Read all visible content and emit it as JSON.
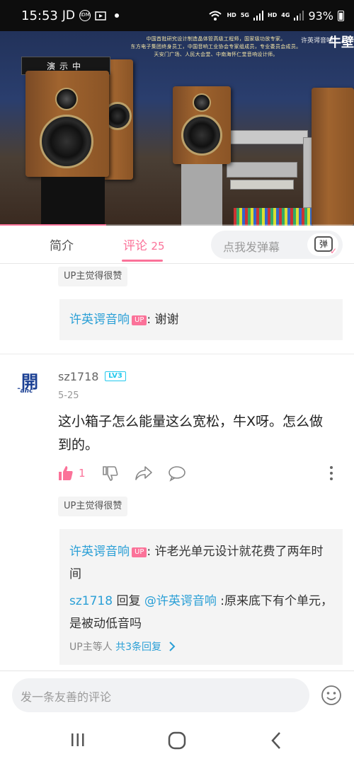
{
  "status_bar": {
    "time": "15:53",
    "carrier": "JD",
    "battery": "93%",
    "net_hd_1": "HD",
    "net_5g": "5G",
    "net_hd_2": "HD",
    "net_4g": "4G"
  },
  "video": {
    "banner_line1": "中国首批研究设计制造晶体管高级工程师，国家级功放专家。",
    "banner_line2": "东方电子集团终身员工，中国音响工业协会专家组成员，专业委员会成员。",
    "banner_line3": "天安门广场、人民大会堂、中南海怀仁堂音响设计师。",
    "watermark": "许英谔音响",
    "corner_text": "牛壁",
    "sign_text": "演示中",
    "progress_fraction": 0.3
  },
  "tabs": {
    "intro": "简介",
    "comments": "评论",
    "comments_count": "25",
    "danmaku_placeholder": "点我发弹幕",
    "danmaku_button": "弹"
  },
  "thread1": {
    "badge": "UP主觉得很赞",
    "reply_author": "许英谔音响",
    "up_tag": "UP",
    "reply_text": ": 谢谢"
  },
  "comment2": {
    "avatar_mark": "開",
    "avatar_sub": "Canc",
    "username": "sz1718",
    "level": "LV3",
    "date": "5-25",
    "text": "这小箱子怎么能量这么宽松，牛X呀。怎么做到的。",
    "like_count": "1",
    "badge": "UP主觉得很赞",
    "reply1_author": "许英谔音响",
    "reply1_up_tag": "UP",
    "reply1_text": ": 许老光单元设计就花费了两年时间",
    "reply2_author": "sz1718",
    "reply2_verb": " 回复 ",
    "reply2_mention": "@许英谔音响",
    "reply2_text": " :原来底下有个单元，是被动低音吗",
    "more_prefix": "UP主等人 ",
    "more_link": "共3条回复"
  },
  "bottom": {
    "comment_placeholder": "发一条友善的评论"
  },
  "colors": {
    "accent_pink": "#fb7299",
    "link_blue": "#2a9fd6",
    "level_cyan": "#23c9ed"
  }
}
